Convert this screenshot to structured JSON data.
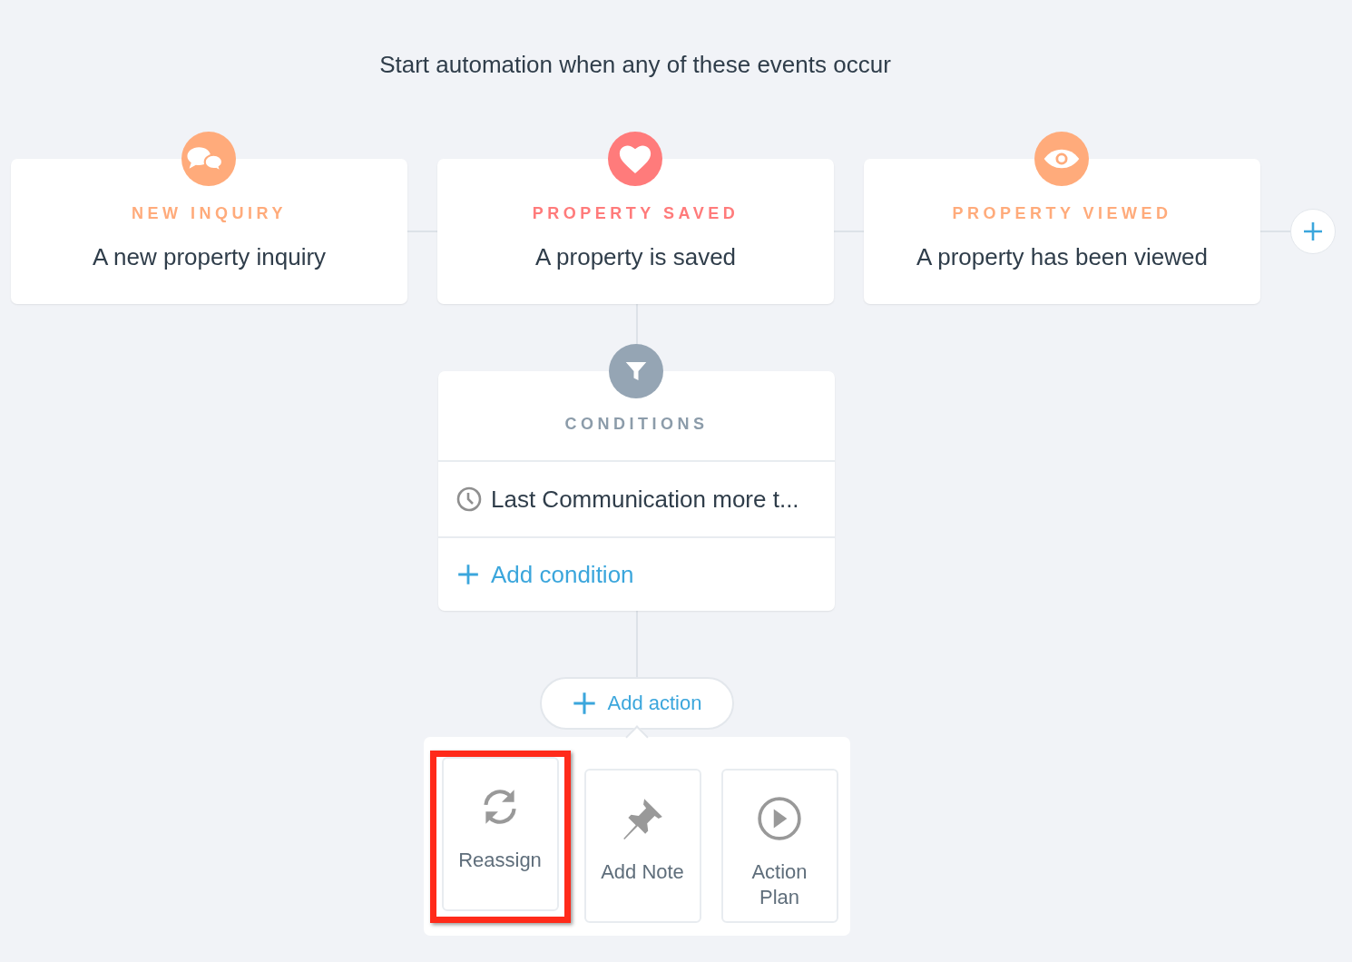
{
  "heading": "Start automation when any of these events occur",
  "triggers": [
    {
      "kind": "chat",
      "color": "#ffab7b",
      "label": "NEW INQUIRY",
      "description": "A new property inquiry"
    },
    {
      "kind": "heart",
      "color": "#ff7b7b",
      "label": "PROPERTY SAVED",
      "description": "A property is saved"
    },
    {
      "kind": "eye",
      "color": "#ffab7b",
      "label": "PROPERTY VIEWED",
      "description": "A property has been viewed"
    }
  ],
  "conditions": {
    "title": "CONDITIONS",
    "items": [
      {
        "kind": "clock",
        "text": "Last Communication more t..."
      }
    ],
    "add_label": "Add condition"
  },
  "add_action": {
    "label": "Add action"
  },
  "actions": [
    {
      "kind": "reassign",
      "label": "Reassign",
      "highlighted": true
    },
    {
      "kind": "note",
      "label": "Add Note",
      "highlighted": false
    },
    {
      "kind": "plan",
      "label": "Action Plan",
      "highlighted": false
    }
  ]
}
